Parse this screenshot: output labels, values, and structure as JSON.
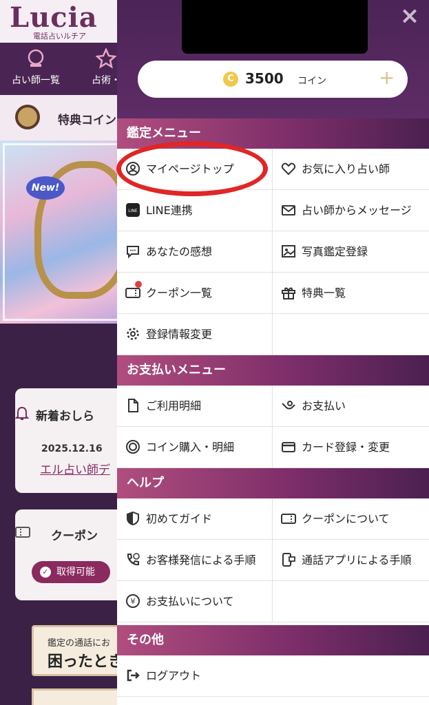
{
  "background": {
    "logo": "Lucia",
    "logo_sub": "電話占いルチア",
    "nav": [
      {
        "label": "占い師一覧",
        "icon": "crystal-ball-icon"
      },
      {
        "label": "占術・",
        "icon": "star-icon"
      }
    ],
    "coin_bar_text": "特典コイン",
    "banner_badge": "New!",
    "news_title": "新着おしら",
    "news_date": "2025.12.16",
    "news_link": "エル占い師デ",
    "coupon_title": "クーポン",
    "coupon_badge": "取得可能",
    "trouble_small": "鑑定の通話にお",
    "trouble_big": "困ったとき"
  },
  "drawer": {
    "close_label": "×",
    "coin": {
      "symbol": "C",
      "amount": "3500",
      "unit": "コイン",
      "plus": "+"
    },
    "sections": [
      {
        "title": "鑑定メニュー",
        "items": [
          {
            "label": "マイページトップ",
            "icon": "user-circle-icon"
          },
          {
            "label": "お気に入り占い師",
            "icon": "heart-icon"
          },
          {
            "label": "LINE連携",
            "icon": "line-icon"
          },
          {
            "label": "占い師からメッセージ",
            "icon": "envelope-icon"
          },
          {
            "label": "あなたの感想",
            "icon": "comment-icon"
          },
          {
            "label": "写真鑑定登録",
            "icon": "photo-icon"
          },
          {
            "label": "クーポン一覧",
            "icon": "ticket-icon"
          },
          {
            "label": "特典一覧",
            "icon": "gift-icon"
          },
          {
            "label": "登録情報変更",
            "icon": "gear-icon"
          },
          {
            "label": "",
            "icon": ""
          }
        ]
      },
      {
        "title": "お支払いメニュー",
        "items": [
          {
            "label": "ご利用明細",
            "icon": "document-icon"
          },
          {
            "label": "お支払い",
            "icon": "payment-hand-icon"
          },
          {
            "label": "コイン購入・明細",
            "icon": "coin-ring-icon"
          },
          {
            "label": "カード登録・変更",
            "icon": "credit-card-icon"
          }
        ]
      },
      {
        "title": "ヘルプ",
        "items": [
          {
            "label": "初めてガイド",
            "icon": "shield-icon"
          },
          {
            "label": "クーポンについて",
            "icon": "ticket-icon"
          },
          {
            "label": "お客様発信による手順",
            "icon": "phone-call-icon"
          },
          {
            "label": "通話アプリによる手順",
            "icon": "phone-app-icon"
          },
          {
            "label": "お支払いについて",
            "icon": "yen-icon"
          },
          {
            "label": "",
            "icon": ""
          }
        ]
      },
      {
        "title": "その他",
        "items": [
          {
            "label": "ログアウト",
            "icon": "logout-icon"
          }
        ]
      }
    ]
  },
  "colors": {
    "accent": "#7e2e6a",
    "highlight": "#e02626",
    "coin": "#f2c84b"
  }
}
